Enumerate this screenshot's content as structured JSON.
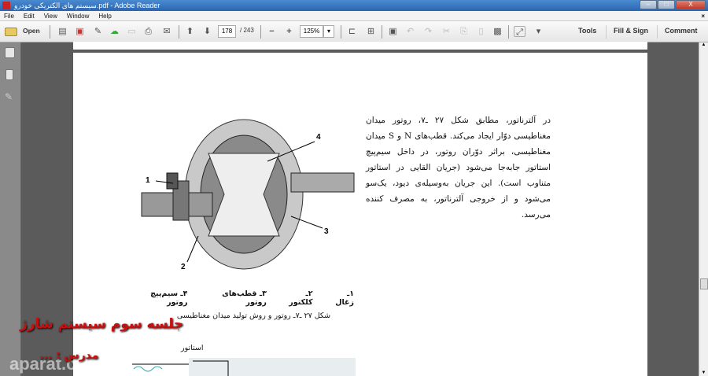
{
  "window": {
    "title": "سیستم های الکتریکی خودرو.pdf - Adobe Reader",
    "minimize": "–",
    "maximize": "□",
    "close": "X"
  },
  "menu": [
    "File",
    "Edit",
    "View",
    "Window",
    "Help"
  ],
  "menu_close": "×",
  "toolbar": {
    "open": "Open",
    "page_current": "178",
    "page_total": "/ 243",
    "zoom": "125%",
    "tools": "Tools",
    "fill_sign": "Fill & Sign",
    "comment": "Comment"
  },
  "document": {
    "paragraph": "در آلترناتور، مطابق شکل ۲۷ ـ۷، روتور میدان مغناطیسی دوّار ایجاد می‌کند. قطب‌های N و S میدان مغناطیسی، براثر دوّران روتور، در داخل سیم‌پیچ استاتور جابه‌جا می‌شود (جریان القایی در استاتور متناوب است). این جریان به‌وسیله‌ی دیود، یک‌سو می‌شود و از خروجی آلترناتور، به مصرف کننده می‌رسد.",
    "figure_labels": [
      "1",
      "2",
      "3",
      "4"
    ],
    "legend": [
      "۱ـ زغال",
      "۲ـ کلکتور",
      "۳ـ قطب‌های روتور",
      "۴ـ سیم‌پیچ روتور"
    ],
    "caption": "شکل ۲۷ ـ۷ـ روتور و روش تولید میدان مغناطیسی",
    "stator_label": "استاتور"
  },
  "overlay": {
    "title": "جلسه سوم سیستم شارژ",
    "teacher": "مدرس : ...",
    "watermark": "aparat.com"
  }
}
